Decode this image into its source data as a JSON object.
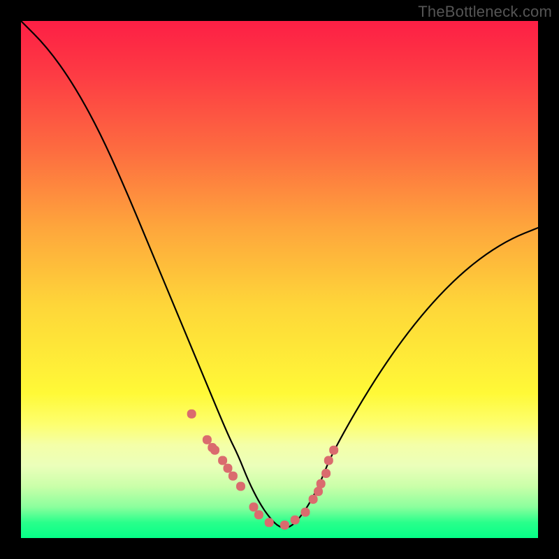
{
  "watermark": "TheBottleneck.com",
  "chart_data": {
    "type": "line",
    "title": "",
    "xlabel": "",
    "ylabel": "",
    "xlim": [
      0,
      100
    ],
    "ylim": [
      0,
      100
    ],
    "legend": false,
    "grid": false,
    "series": [
      {
        "name": "bottleneck-curve",
        "x": [
          0,
          5,
          10,
          15,
          20,
          25,
          30,
          35,
          40,
          42,
          44,
          46,
          48,
          50,
          52,
          54,
          56,
          58,
          60,
          65,
          70,
          75,
          80,
          85,
          90,
          95,
          100
        ],
        "y": [
          100,
          95,
          88,
          79,
          68,
          56,
          44,
          32,
          20,
          16,
          11,
          7,
          4,
          2,
          2,
          4,
          7,
          11,
          16,
          25,
          33,
          40,
          46,
          51,
          55,
          58,
          60
        ]
      }
    ],
    "scatter": {
      "name": "marker-points",
      "x": [
        33,
        36,
        37,
        37.5,
        39,
        40,
        41,
        42.5,
        45,
        46,
        48,
        51,
        53,
        55,
        56.5,
        57.5,
        58,
        59,
        59.5,
        60.5
      ],
      "y": [
        24,
        19,
        17.5,
        17,
        15,
        13.5,
        12,
        10,
        6,
        4.5,
        3,
        2.5,
        3.5,
        5,
        7.5,
        9,
        10.5,
        12.5,
        15,
        17
      ]
    },
    "colors": {
      "curve": "#000000",
      "markers": "#DA6B6E",
      "background_gradient": [
        "#FD1F45",
        "#FD6C40",
        "#FEA63C",
        "#FED639",
        "#FFF937",
        "#FDFF6F",
        "#F4FFA8",
        "#CAFFA9",
        "#8BFF9D",
        "#05FF87"
      ]
    }
  }
}
